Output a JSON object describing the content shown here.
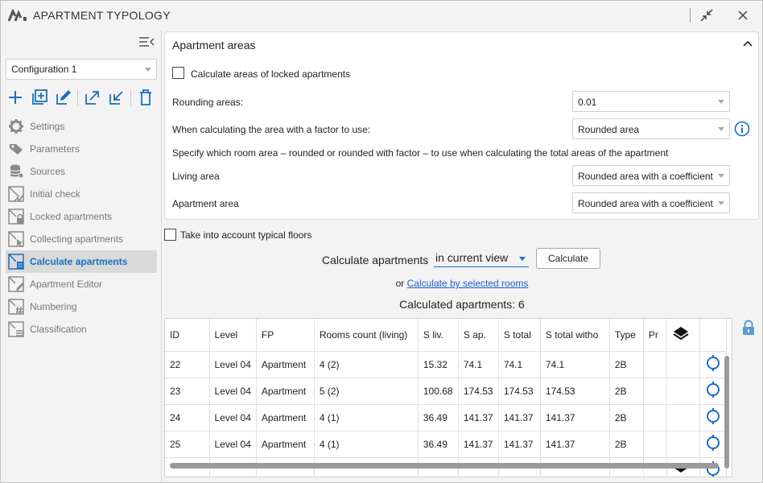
{
  "window": {
    "title": "APARTMENT TYPOLOGY",
    "icons": [
      "restore-icon",
      "close-icon"
    ]
  },
  "sidebar": {
    "configuration": "Configuration 1",
    "toolbar_icons": [
      "add-icon",
      "duplicate-icon",
      "edit-icon",
      "export-icon",
      "import-icon",
      "delete-icon"
    ],
    "items": [
      {
        "label": "Settings",
        "icon": "gear-icon",
        "active": false
      },
      {
        "label": "Parameters",
        "icon": "tag-icon",
        "active": false
      },
      {
        "label": "Sources",
        "icon": "database-icon",
        "active": false
      },
      {
        "label": "Initial check",
        "icon": "check-plan-icon",
        "active": false
      },
      {
        "label": "Locked apartments",
        "icon": "lock-plan-icon",
        "active": false
      },
      {
        "label": "Collecting apartments",
        "icon": "cursor-plan-icon",
        "active": false
      },
      {
        "label": "Calculate apartments",
        "icon": "calculator-plan-icon",
        "active": true
      },
      {
        "label": "Apartment Editor",
        "icon": "pencil-plan-icon",
        "active": false
      },
      {
        "label": "Numbering",
        "icon": "hash-plan-icon",
        "active": false
      },
      {
        "label": "Classification",
        "icon": "classify-plan-icon",
        "active": false
      }
    ]
  },
  "panel": {
    "title": "Apartment areas",
    "locked_checkbox_label": "Calculate areas of locked apartments",
    "rounding_label": "Rounding areas:",
    "rounding_value": "0.01",
    "factor_label": "When calculating the area with a factor to use:",
    "factor_value": "Rounded area",
    "specify_text": "Specify which room area – rounded or rounded with factor – to use when calculating the total areas of the apartment",
    "living_label": "Living area",
    "living_value": "Rounded area with a coefficient",
    "apartment_label": "Apartment area",
    "apartment_value": "Rounded area with a coefficient"
  },
  "typical_floors_label": "Take into account typical floors",
  "calculate": {
    "label": "Calculate apartments",
    "view_option": "in current view",
    "button": "Calculate",
    "or_text": "or",
    "link": "Calculate by selected rooms",
    "count_text": "Calculated apartments: 6"
  },
  "table": {
    "headers": [
      "ID",
      "Level",
      "FP",
      "Rooms count (living)",
      "S liv.",
      "S ap.",
      "S total",
      "S total witho",
      "Type",
      "Pr"
    ],
    "rows": [
      [
        "22",
        "Level 04",
        "Apartment",
        "4 (2)",
        "15.32",
        "74.1",
        "74.1",
        "74.1",
        "2B",
        ""
      ],
      [
        "23",
        "Level 04",
        "Apartment",
        "5 (2)",
        "100.68",
        "174.53",
        "174.53",
        "174.53",
        "2B",
        ""
      ],
      [
        "24",
        "Level 04",
        "Apartment",
        "4 (1)",
        "36.49",
        "141.37",
        "141.37",
        "141.37",
        "2B",
        ""
      ],
      [
        "25",
        "Level 04",
        "Apartment",
        "4 (1)",
        "36.49",
        "141.37",
        "141.37",
        "141.37",
        "2B",
        ""
      ],
      [
        "",
        "",
        "",
        "",
        "",
        "",
        "",
        "",
        "",
        ""
      ]
    ]
  },
  "colors": {
    "accent": "#1a6fc0",
    "link": "#1a5bd0",
    "active_bg": "#d9d9d9"
  }
}
